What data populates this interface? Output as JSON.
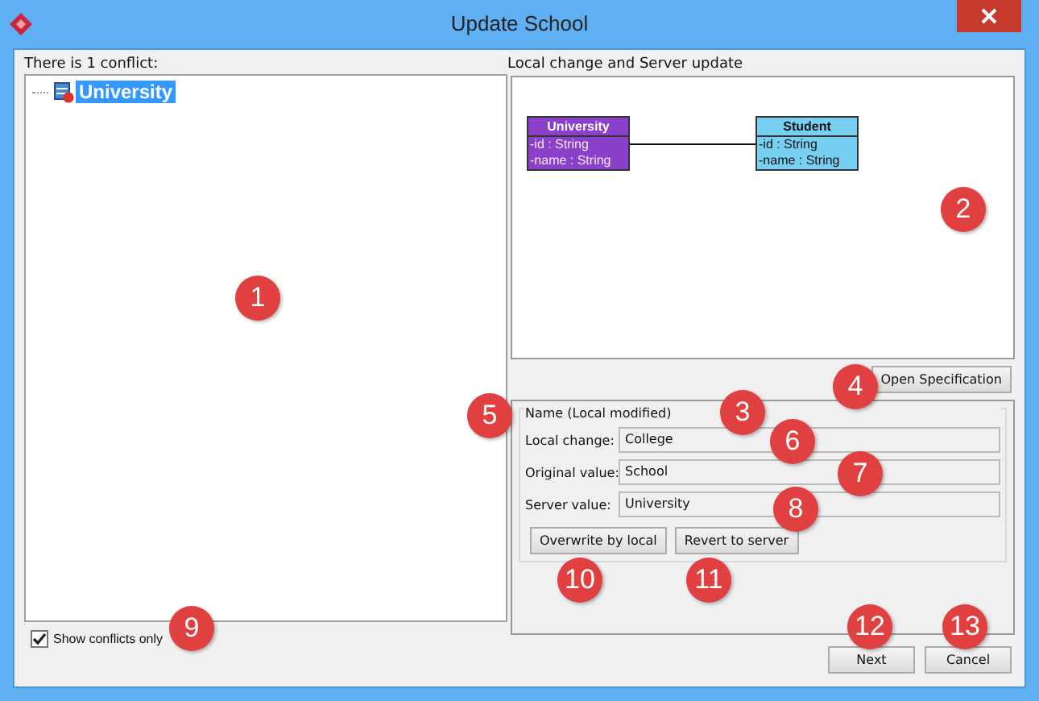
{
  "window": {
    "title": "Update School"
  },
  "conflict_summary": "There is 1 conflict:",
  "tree": {
    "items": [
      {
        "label": "University",
        "selected": true,
        "error": true
      }
    ]
  },
  "show_conflicts_only": {
    "label": "Show conflicts only",
    "checked": true
  },
  "diagram": {
    "title": "Local change and Server update",
    "classes": [
      {
        "name": "University",
        "changed": true,
        "attributes": [
          "-id : String",
          "-name : String"
        ]
      },
      {
        "name": "Student",
        "changed": false,
        "attributes": [
          "-id : String",
          "-name : String"
        ]
      }
    ]
  },
  "open_specification": "Open Specification",
  "details": {
    "group": "Name (Local modified)",
    "fields": [
      {
        "label": "Local change:",
        "value": "College"
      },
      {
        "label": "Original value:",
        "value": "School"
      },
      {
        "label": "Server value:",
        "value": "University"
      }
    ],
    "buttons": [
      "Overwrite by local",
      "Revert to server"
    ]
  },
  "footer_buttons": [
    "Next",
    "Cancel"
  ],
  "callouts": [
    "1",
    "2",
    "3",
    "4",
    "5",
    "6",
    "7",
    "8",
    "9",
    "10",
    "11",
    "12",
    "13"
  ]
}
